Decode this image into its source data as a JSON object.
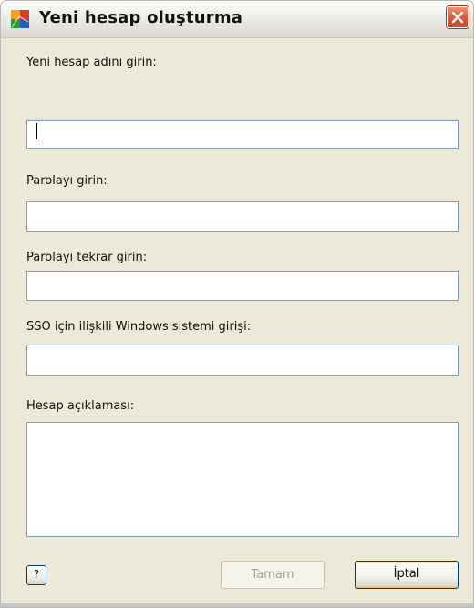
{
  "window": {
    "title": "Yeni hesap oluşturma"
  },
  "form": {
    "account_name_label": "Yeni hesap adını girin:",
    "account_name_value": "",
    "password_label": "Parolayı girin:",
    "password_value": "",
    "password_repeat_label": "Parolayı tekrar girin:",
    "password_repeat_value": "",
    "sso_label": "SSO için ilişkili Windows sistemi girişi:",
    "sso_value": "",
    "description_label": "Hesap açıklaması:",
    "description_value": ""
  },
  "buttons": {
    "help_label": "?",
    "ok_label": "Tamam",
    "cancel_label": "İptal"
  },
  "icons": {
    "app": "avg-logo-icon",
    "close": "close-icon"
  },
  "colors": {
    "close_red": "#d55a37",
    "field_border": "#7f9db9",
    "dialog_bg": "#ece9d8"
  }
}
